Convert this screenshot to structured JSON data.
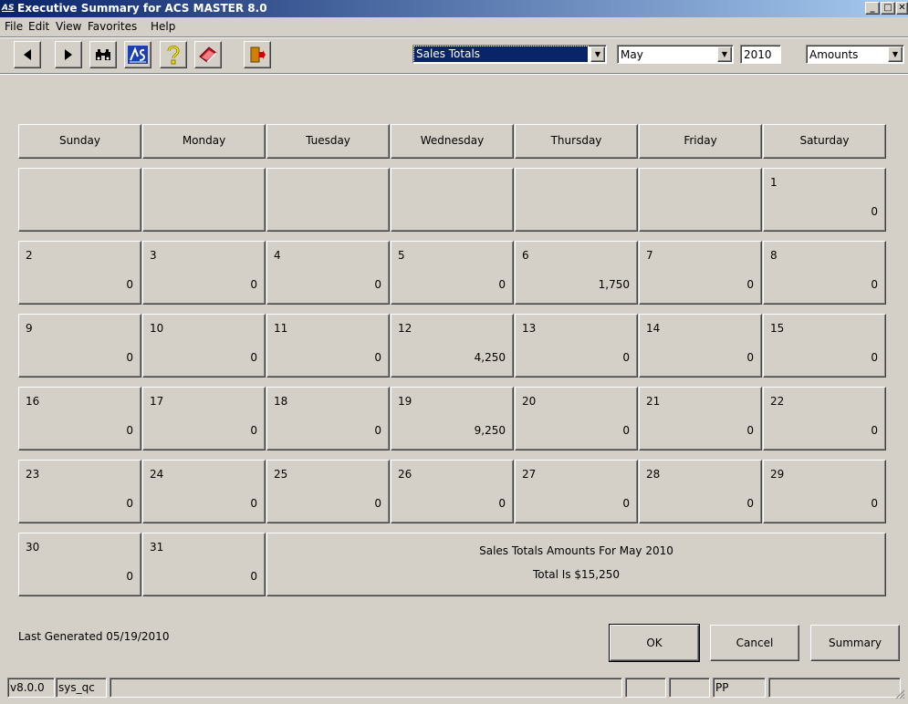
{
  "window": {
    "title": "Executive Summary for ACS MASTER 8.0",
    "logo_text": "AS"
  },
  "menu": [
    "File",
    "Edit",
    "View",
    "Favorites",
    "Help"
  ],
  "toolbar": {
    "icons": [
      "back-arrow-icon",
      "forward-arrow-icon",
      "binoculars-icon",
      "acs-logo-icon",
      "help-question-icon",
      "book-icon",
      "exit-door-icon"
    ],
    "report_select": "Sales Totals",
    "month_select": "May",
    "year_field": "2010",
    "mode_select": "Amounts"
  },
  "calendar": {
    "weekdays": [
      "Sunday",
      "Monday",
      "Tuesday",
      "Wednesday",
      "Thursday",
      "Friday",
      "Saturday"
    ],
    "days": [
      {
        "day": "1",
        "value": "0"
      },
      {
        "day": "2",
        "value": "0"
      },
      {
        "day": "3",
        "value": "0"
      },
      {
        "day": "4",
        "value": "0"
      },
      {
        "day": "5",
        "value": "0"
      },
      {
        "day": "6",
        "value": "1,750"
      },
      {
        "day": "7",
        "value": "0"
      },
      {
        "day": "8",
        "value": "0"
      },
      {
        "day": "9",
        "value": "0"
      },
      {
        "day": "10",
        "value": "0"
      },
      {
        "day": "11",
        "value": "0"
      },
      {
        "day": "12",
        "value": "4,250"
      },
      {
        "day": "13",
        "value": "0"
      },
      {
        "day": "14",
        "value": "0"
      },
      {
        "day": "15",
        "value": "0"
      },
      {
        "day": "16",
        "value": "0"
      },
      {
        "day": "17",
        "value": "0"
      },
      {
        "day": "18",
        "value": "0"
      },
      {
        "day": "19",
        "value": "9,250"
      },
      {
        "day": "20",
        "value": "0"
      },
      {
        "day": "21",
        "value": "0"
      },
      {
        "day": "22",
        "value": "0"
      },
      {
        "day": "23",
        "value": "0"
      },
      {
        "day": "24",
        "value": "0"
      },
      {
        "day": "25",
        "value": "0"
      },
      {
        "day": "26",
        "value": "0"
      },
      {
        "day": "27",
        "value": "0"
      },
      {
        "day": "28",
        "value": "0"
      },
      {
        "day": "29",
        "value": "0"
      },
      {
        "day": "30",
        "value": "0"
      },
      {
        "day": "31",
        "value": "0"
      }
    ],
    "summary_line1": "Sales Totals Amounts For May 2010",
    "summary_line2": "Total Is $15,250"
  },
  "footer": {
    "last_generated": "Last Generated 05/19/2010",
    "ok_label": "OK",
    "cancel_label": "Cancel",
    "summary_label": "Summary"
  },
  "statusbar": {
    "version": "v8.0.0",
    "user": "sys_qc",
    "initials": "PP"
  },
  "colors": {
    "face": "#d4d0c8",
    "title_start": "#0a246a",
    "title_end": "#a6caf0",
    "selection": "#0a246a"
  }
}
